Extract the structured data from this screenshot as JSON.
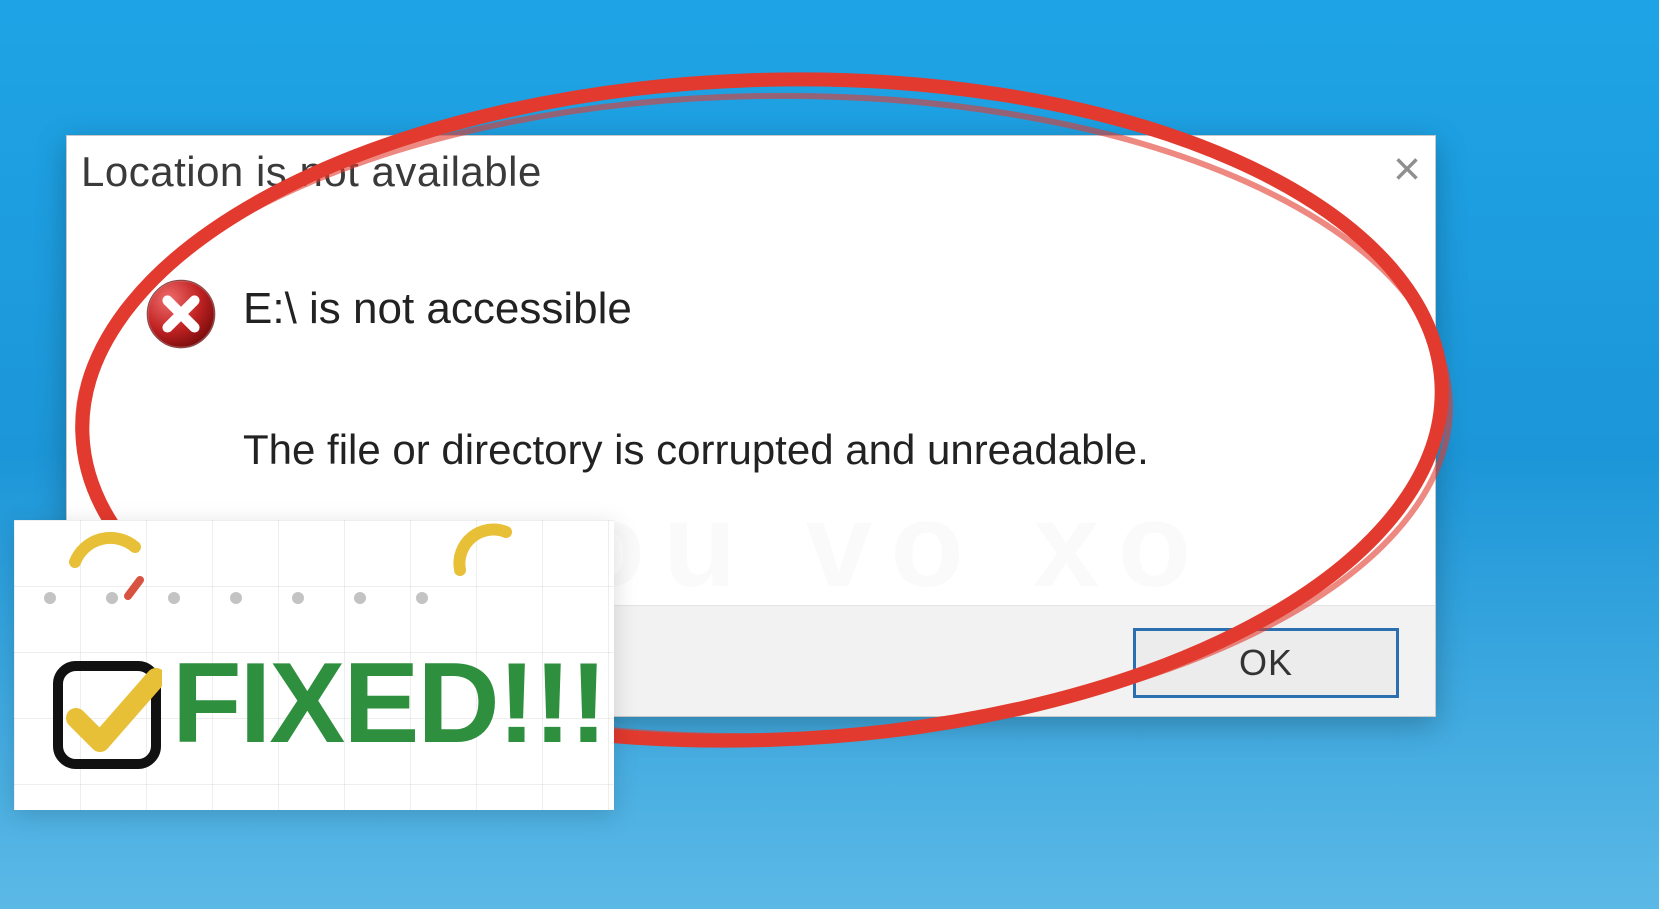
{
  "dialog": {
    "title": "Location is not available",
    "message_heading": "E:\\ is not accessible",
    "message_body": "The file or directory is corrupted and unreadable.",
    "ok_label": "OK",
    "close_label": "×"
  },
  "badge": {
    "text": "FIXED!!!"
  },
  "watermark": "you vo xo",
  "colors": {
    "desktop_blue": "#1e9fe1",
    "accent_red": "#e23a2e",
    "fixed_green": "#2e8f3e",
    "confetti_yellow": "#e8c038",
    "error_icon_red": "#b51f1f"
  }
}
